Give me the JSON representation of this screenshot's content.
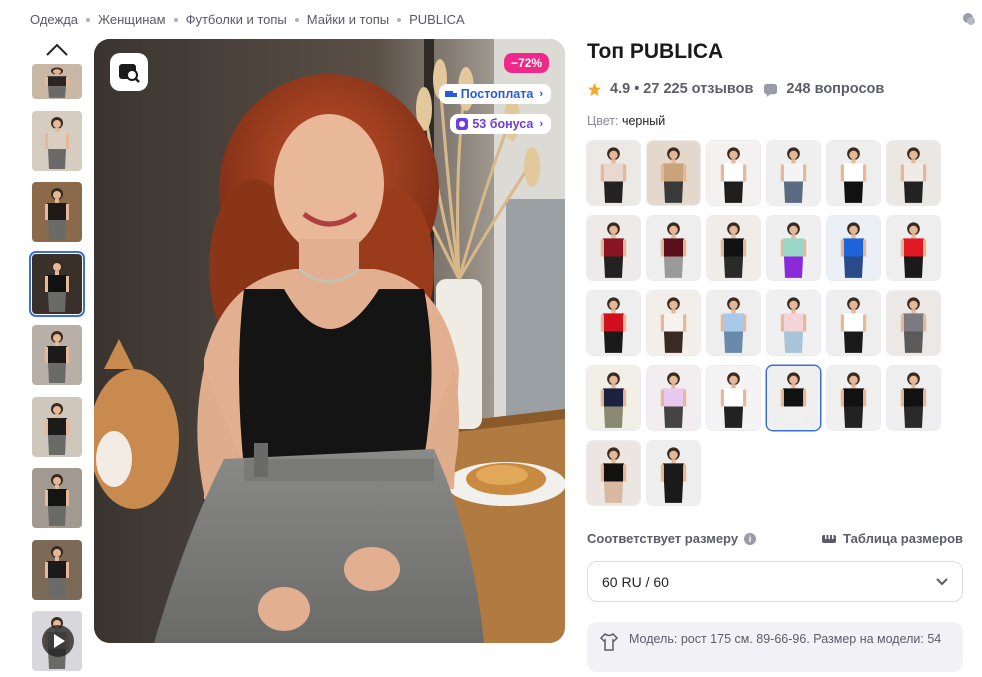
{
  "breadcrumb": [
    "Одежда",
    "Женщинам",
    "Футболки и топы",
    "Майки и топы",
    "PUBLICA"
  ],
  "product": {
    "title": "Топ PUBLICA",
    "rating": "4.9",
    "reviews": "• 27 225 отзывов",
    "questions": "248 вопросов",
    "color_label": "Цвет:",
    "color_value": "черный"
  },
  "gallery": {
    "discount": "−72%",
    "postpay": "Постоплата",
    "bonus": "53 бонуса",
    "active_thumb_index": 3
  },
  "thumbs": [
    {
      "top": "#c7b7a4",
      "shirt": "#2a2624"
    },
    {
      "top": "#d6ccc0",
      "shirt": "#d9cfc0"
    },
    {
      "top": "#8a6a4a",
      "shirt": "#1e1a18"
    },
    {
      "top": "#3a302a",
      "shirt": "#111111"
    },
    {
      "top": "#b8b0a6",
      "shirt": "#1a1a1a"
    },
    {
      "top": "#cfc7bc",
      "shirt": "#1b1b1b"
    },
    {
      "top": "#a29a90",
      "shirt": "#141414"
    },
    {
      "top": "#7c6a58",
      "shirt": "#1a1a1a"
    },
    {
      "top": "#d8d8dc",
      "shirt": "#9a9aa0"
    }
  ],
  "swatches": [
    {
      "bg": "#ece8e4",
      "top": "#e8d8d0",
      "bottom": "#222222"
    },
    {
      "bg": "#e4d8cc",
      "top": "#c9a37a",
      "bottom": "#3a3a3a"
    },
    {
      "bg": "#f4f2f0",
      "top": "#ffffff",
      "bottom": "#1e1e1e"
    },
    {
      "bg": "#efefef",
      "top": "#f4f4f4",
      "bottom": "#5a6a80"
    },
    {
      "bg": "#eeeeee",
      "top": "#ffffff",
      "bottom": "#111111"
    },
    {
      "bg": "#ebe7e3",
      "top": "#f0ebe6",
      "bottom": "#222222"
    },
    {
      "bg": "#eeeaea",
      "top": "#8a1424",
      "bottom": "#222222"
    },
    {
      "bg": "#eeeeee",
      "top": "#5a0f18",
      "bottom": "#9a9a9a"
    },
    {
      "bg": "#f0ece8",
      "top": "#111111",
      "bottom": "#2a2a2a"
    },
    {
      "bg": "#efefef",
      "top": "#9ad6c8",
      "bottom": "#8a2ad8"
    },
    {
      "bg": "#eaf0f6",
      "top": "#1f63d8",
      "bottom": "#2a4a8a"
    },
    {
      "bg": "#eeeeee",
      "top": "#e01822",
      "bottom": "#1a1a1a"
    },
    {
      "bg": "#eeeeee",
      "top": "#d0101e",
      "bottom": "#1a1a1a"
    },
    {
      "bg": "#f2eeea",
      "top": "#f6f2ee",
      "bottom": "#3a2a22"
    },
    {
      "bg": "#eeeeee",
      "top": "#a8c8ec",
      "bottom": "#6a8aac"
    },
    {
      "bg": "#f0f0f0",
      "top": "#f4d4d8",
      "bottom": "#a8c4d8"
    },
    {
      "bg": "#eeeeee",
      "top": "#ffffff",
      "bottom": "#1a1a1a"
    },
    {
      "bg": "#ece8e6",
      "top": "#7a7a80",
      "bottom": "#5a5a5a"
    },
    {
      "bg": "#f2efe6",
      "top": "#1a2240",
      "bottom": "#8a8a70"
    },
    {
      "bg": "#f2eef0",
      "top": "#e8c8f0",
      "bottom": "#444444"
    },
    {
      "bg": "#f4f4f4",
      "top": "#ffffff",
      "bottom": "#222222"
    },
    {
      "bg": "#efefef",
      "top": "#111111",
      "bottom": "#f0f0f0"
    },
    {
      "bg": "#f0f0f0",
      "top": "#111111",
      "bottom": "#222222"
    },
    {
      "bg": "#eeeeee",
      "top": "#111111",
      "bottom": "#2a2a2a"
    },
    {
      "bg": "#ece6e0",
      "top": "#111111",
      "bottom": "#d8b8a0"
    },
    {
      "bg": "#eeeeee",
      "top": "#1a1a1a",
      "bottom": "#1a1a1a"
    }
  ],
  "selected_swatch": 21,
  "size": {
    "fit_label": "Соответствует размеру",
    "table_label": "Таблица размеров",
    "selected": "60 RU / 60",
    "model_info": "Модель: рост 175 см. 89-66-96. Размер на модели: 54"
  },
  "colors": {
    "accent": "#3b6fd8",
    "discount": "#f0288a",
    "postpay": "#2a5ad8",
    "bonus": "#6a3ee0",
    "star": "#f5a623"
  }
}
